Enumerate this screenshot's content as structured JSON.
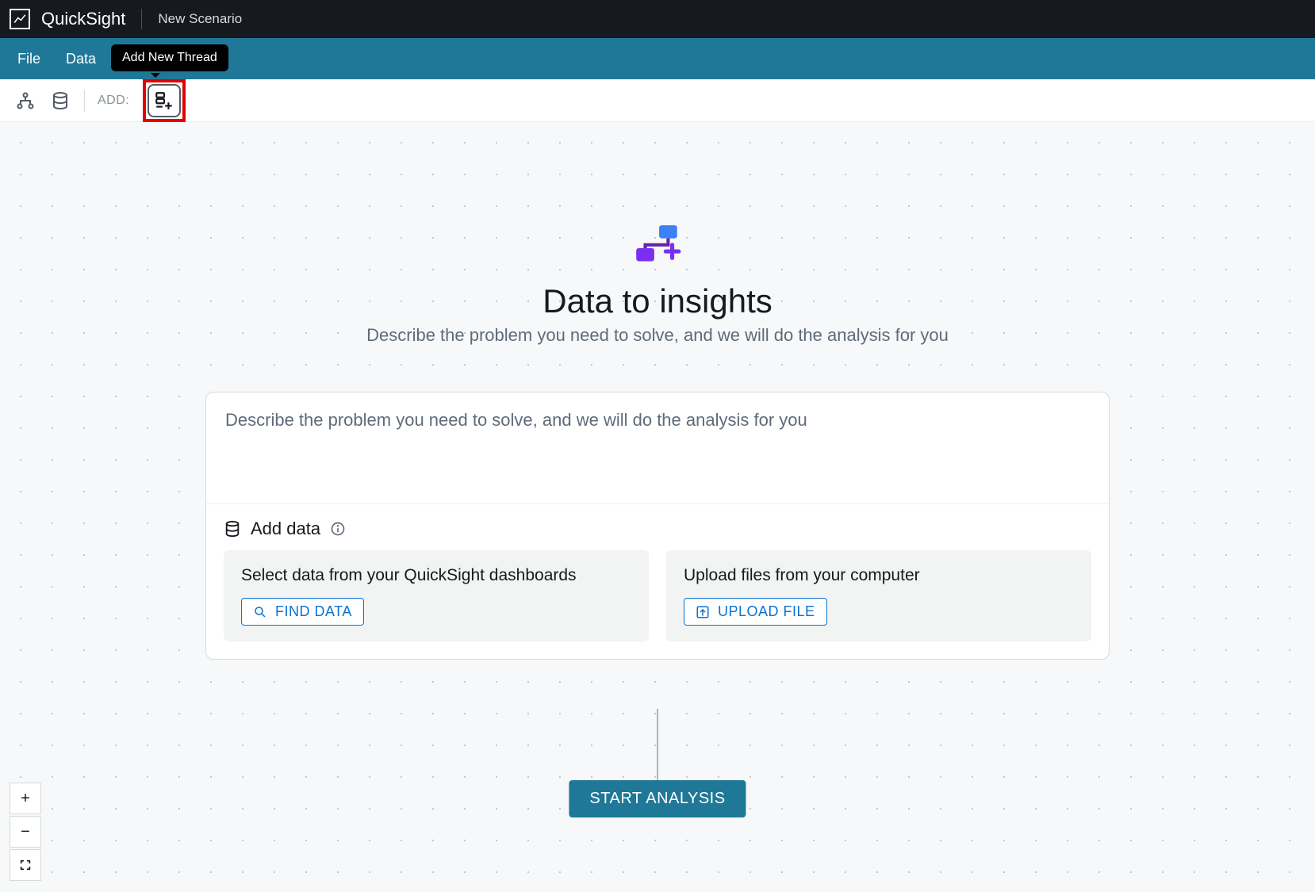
{
  "topbar": {
    "brand": "QuickSight",
    "scenario_name": "New Scenario"
  },
  "menubar": {
    "items": [
      "File",
      "Data"
    ]
  },
  "tooltip": {
    "add_thread": "Add New Thread"
  },
  "toolbar": {
    "add_label": "ADD:"
  },
  "hero": {
    "title": "Data to insights",
    "subtitle": "Describe the problem you need to solve, and we will do the analysis for you"
  },
  "prompt": {
    "placeholder": "Describe the problem you need to solve, and we will do the analysis for you",
    "value": ""
  },
  "add_data": {
    "title": "Add data",
    "tiles": [
      {
        "title": "Select data from your QuickSight dashboards",
        "button": "FIND DATA"
      },
      {
        "title": "Upload files from your computer",
        "button": "UPLOAD FILE"
      }
    ]
  },
  "actions": {
    "start": "START ANALYSIS"
  },
  "zoom": {
    "in": "+",
    "out": "−"
  }
}
